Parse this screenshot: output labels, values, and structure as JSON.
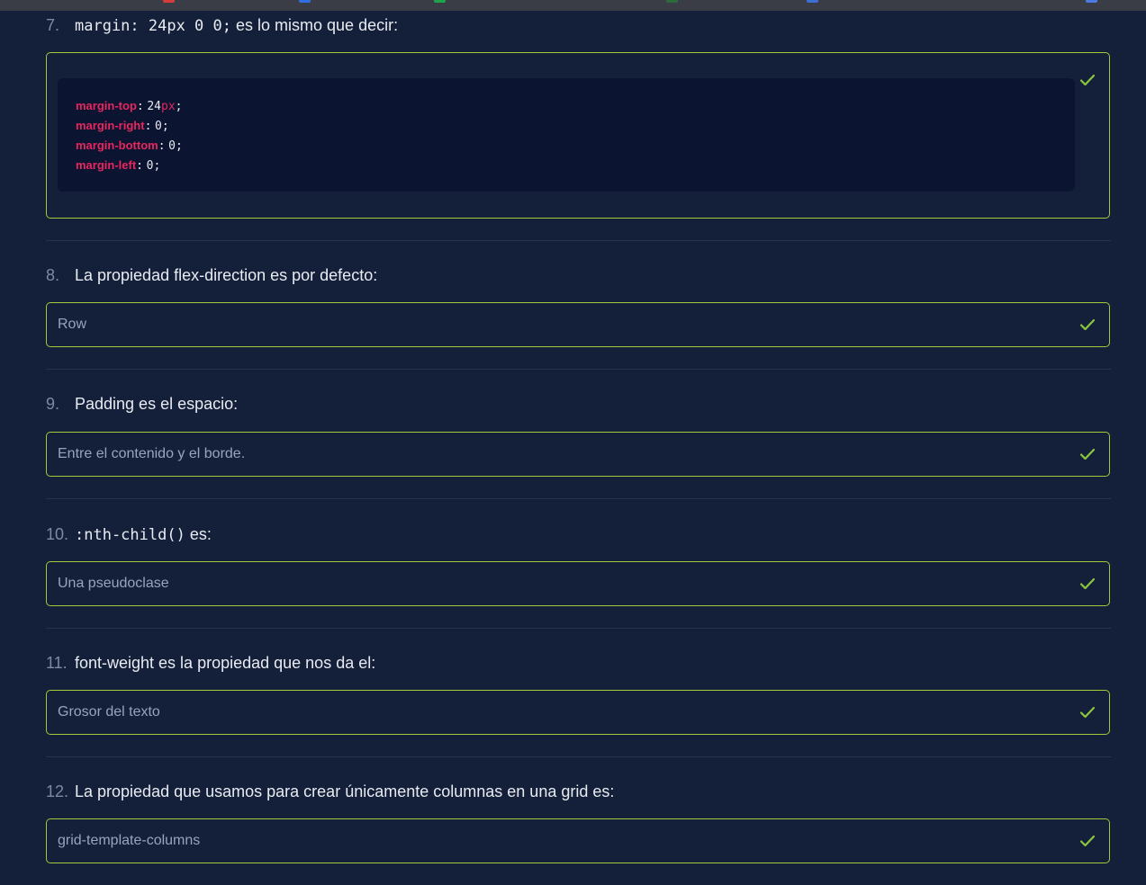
{
  "colors": {
    "background": "#142039",
    "answer_border": "#a3c93a",
    "check": "#8cc63f",
    "code_property": "#e8265f"
  },
  "questions": [
    {
      "number": "7.",
      "title_code": "margin: 24px 0 0;",
      "title_text": "es lo mismo que decir:",
      "answer_code": [
        {
          "prop": "margin-top",
          "colon": ":",
          "value": "24",
          "unit": "px",
          "end": ";"
        },
        {
          "prop": "margin-right",
          "colon": ":",
          "value": "0",
          "end": ";"
        },
        {
          "prop": "margin-bottom",
          "colon": ":",
          "value": "0",
          "end": ";"
        },
        {
          "prop": "margin-left",
          "colon": ":",
          "value": "0",
          "end": ";"
        }
      ],
      "icon": "check-icon"
    },
    {
      "number": "8.",
      "title_text": "La propiedad flex-direction es por defecto:",
      "answer": "Row",
      "icon": "check-icon"
    },
    {
      "number": "9.",
      "title_text": "Padding es el espacio:",
      "answer": "Entre el contenido y el borde.",
      "icon": "check-icon"
    },
    {
      "number": "10.",
      "title_code": ":nth-child()",
      "title_text": "es:",
      "answer": "Una pseudoclase",
      "icon": "check-icon"
    },
    {
      "number": "11.",
      "title_text": "font-weight es la propiedad que nos da el:",
      "answer": "Grosor del texto",
      "icon": "check-icon"
    },
    {
      "number": "12.",
      "title_text": "La propiedad que usamos para crear únicamente columnas en una grid es:",
      "answer": "grid-template-columns",
      "icon": "check-icon"
    }
  ]
}
